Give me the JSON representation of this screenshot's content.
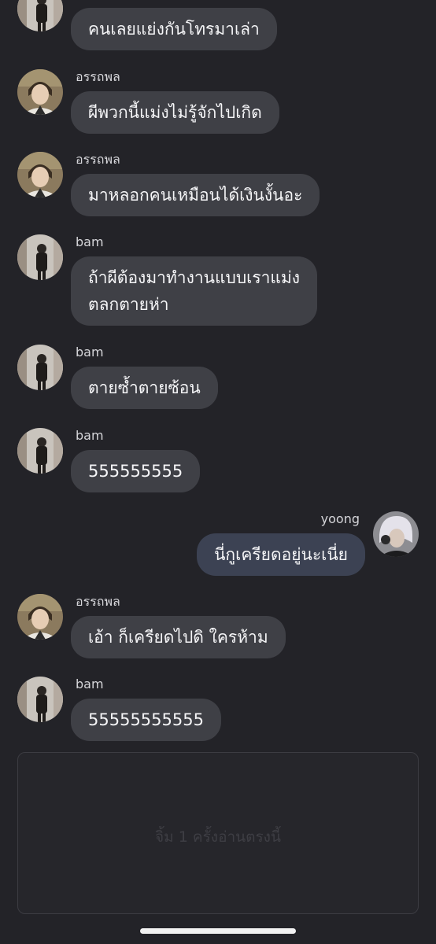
{
  "messages": [
    {
      "sender": "",
      "avatar": "bam",
      "lines": [
        "คนเลยแย่งกันโทรมาเล่า"
      ],
      "direction": "in"
    },
    {
      "sender": "อรรถพล",
      "avatar": "atthaphon",
      "lines": [
        "ผีพวกนี้แม่งไม่รู้จักไปเกิด"
      ],
      "direction": "in"
    },
    {
      "sender": "อรรถพล",
      "avatar": "atthaphon",
      "lines": [
        "มาหลอกคนเหมือนได้เงินงั้นอะ"
      ],
      "direction": "in"
    },
    {
      "sender": "bam",
      "avatar": "bam",
      "lines": [
        "ถ้าผีต้องมาทำงานแบบเราแม่ง",
        "ตลกตายห่า"
      ],
      "direction": "in"
    },
    {
      "sender": "bam",
      "avatar": "bam",
      "lines": [
        "ตายซ้ำตายซ้อน"
      ],
      "direction": "in"
    },
    {
      "sender": "bam",
      "avatar": "bam",
      "lines": [
        "555555555"
      ],
      "direction": "in"
    },
    {
      "sender": "yoong",
      "avatar": "yoong",
      "lines": [
        "นี่กูเครียดอยู่นะเนี่ย"
      ],
      "direction": "out"
    },
    {
      "sender": "อรรถพล",
      "avatar": "atthaphon",
      "lines": [
        "เอ้า ก็เครียดไปดิ ใครห้าม"
      ],
      "direction": "in"
    },
    {
      "sender": "bam",
      "avatar": "bam",
      "lines": [
        "55555555555"
      ],
      "direction": "in"
    }
  ],
  "input_panel": {
    "hint": "จิ้ม 1 ครั้งอ่านตรงนี้"
  },
  "colors": {
    "background": "#232328",
    "bubble_in": "#3f4046",
    "bubble_out": "#3c4253",
    "text": "#f5f5f7"
  }
}
